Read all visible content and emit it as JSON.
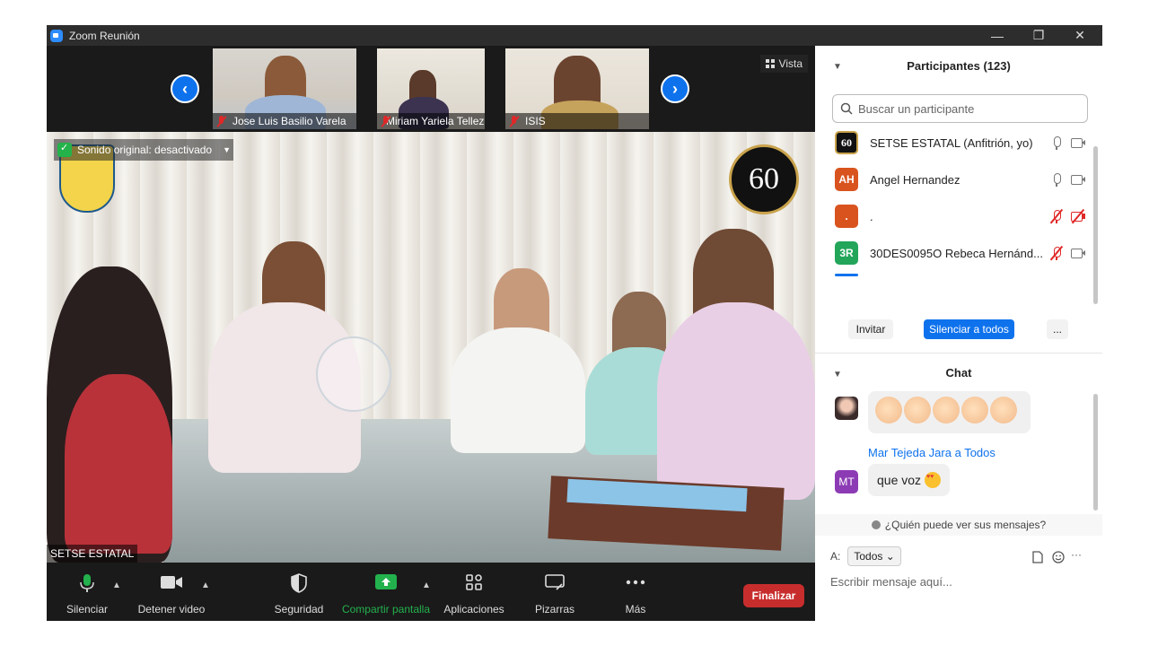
{
  "window": {
    "title": "Zoom Reunión",
    "min": "—",
    "restore": "❐",
    "close": "✕"
  },
  "strip": {
    "thumbs": [
      {
        "name": "Jose Luis Basilio Varela"
      },
      {
        "name": "Miriam Yariela Tellez ..."
      },
      {
        "name": "ISIS"
      }
    ],
    "prev": "‹",
    "next": "›",
    "view_label": "Vista"
  },
  "main_video": {
    "sound_label": "Sonido original: desactivado",
    "logo_text": "60",
    "speaker_name": "SETSE ESTATAL"
  },
  "toolbar": {
    "mute": "Silenciar",
    "video": "Detener video",
    "security": "Seguridad",
    "share": "Compartir pantalla",
    "apps": "Aplicaciones",
    "whiteboards": "Pizarras",
    "more": "Más",
    "end": "Finalizar"
  },
  "participants": {
    "header": "Participantes (123)",
    "search_placeholder": "Buscar un participante",
    "list": [
      {
        "avatar": "60",
        "name": "SETSE ESTATAL (Anfitrión, yo)",
        "color": "#111111",
        "mic_muted": false,
        "cam_off": false
      },
      {
        "avatar": "AH",
        "name": "Angel Hernandez",
        "color": "#d9531e",
        "mic_muted": false,
        "cam_off": false
      },
      {
        "avatar": ".",
        "name": ".",
        "color": "#d9531e",
        "mic_muted": true,
        "cam_off": true
      },
      {
        "avatar": "3R",
        "name": "30DES0095O  Rebeca Hernánd...",
        "color": "#23a55a",
        "mic_muted": true,
        "cam_off": false
      }
    ],
    "invite": "Invitar",
    "mute_all": "Silenciar a todos",
    "more": "..."
  },
  "chat": {
    "header": "Chat",
    "sender": "Mar Tejeda Jara a Todos",
    "sender_avatar": "MT",
    "message": "que voz",
    "who_sees": "¿Quién puede ver sus mensajes?",
    "to_label": "A:",
    "to_value": "Todos",
    "input_placeholder": "Escribir mensaje aquí...",
    "more": "···"
  },
  "colors": {
    "accent": "#0e72ed",
    "end": "#c82d2d",
    "share": "#23b14d"
  }
}
